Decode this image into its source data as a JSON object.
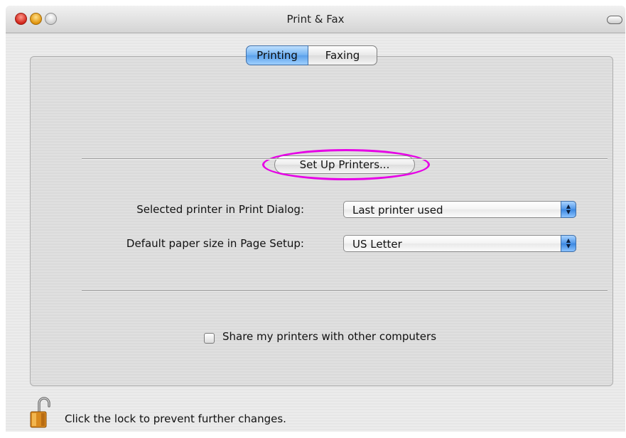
{
  "window": {
    "title": "Print & Fax"
  },
  "tabs": [
    {
      "label": "Printing",
      "selected": true
    },
    {
      "label": "Faxing",
      "selected": false
    }
  ],
  "printing": {
    "setup_button_label": "Set Up Printers...",
    "selected_printer": {
      "label": "Selected printer in Print Dialog:",
      "value": "Last printer used"
    },
    "default_paper": {
      "label": "Default paper size in Page Setup:",
      "value": "US Letter"
    },
    "share_checkbox": {
      "label": "Share my printers with other computers",
      "checked": false
    }
  },
  "footer": {
    "lock_text": "Click the lock to prevent further changes.",
    "lock_icon": "unlocked-padlock-icon"
  },
  "colors": {
    "highlight_ellipse": "#e600e6",
    "selected_tab": "#6fb0f2",
    "popup_arrow": "#4d95e8"
  }
}
